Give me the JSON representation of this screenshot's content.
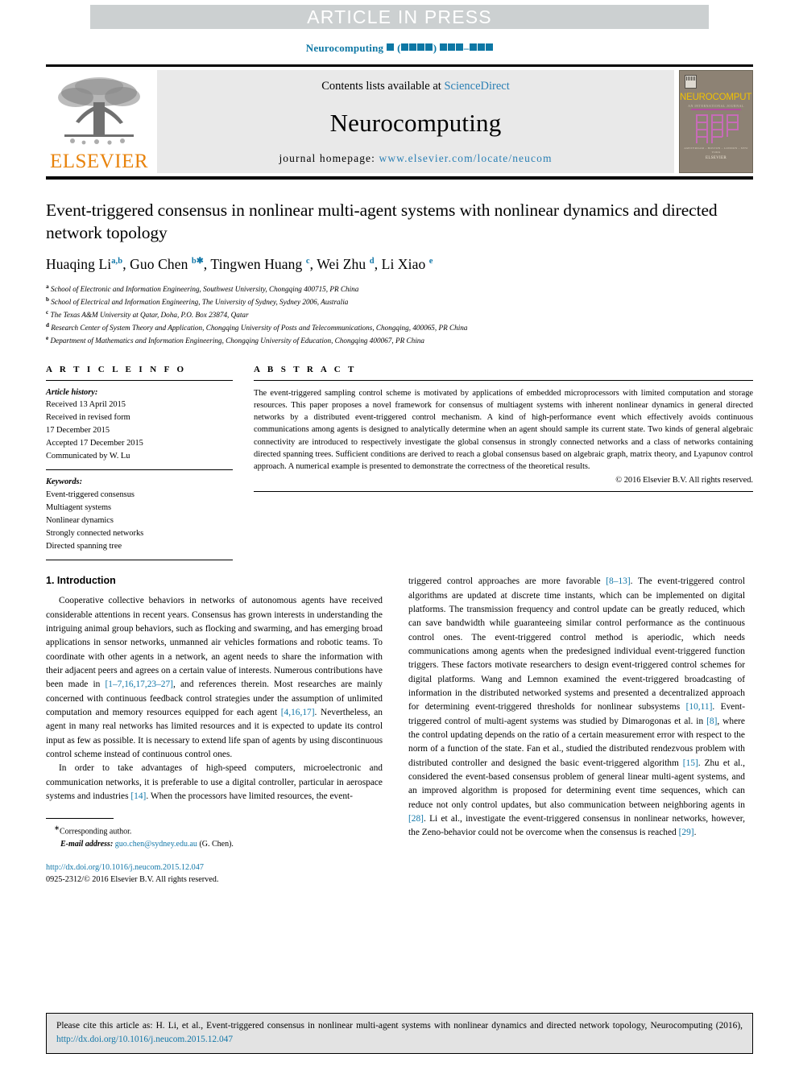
{
  "banner": {
    "text": "ARTICLE IN PRESS"
  },
  "journal_line": {
    "name": "Neurocomputing",
    "placeholder_note": "▮ (▮▮▮▮) ▮▮▮–▮▮▮"
  },
  "masthead": {
    "contents_prefix": "Contents lists available at",
    "contents_link": "ScienceDirect",
    "journal_title": "Neurocomputing",
    "homepage_label": "journal homepage:",
    "homepage_url": "www.elsevier.com/locate/neucom",
    "publisher": "ELSEVIER",
    "cover_title": "NEUROCOMPUTING",
    "cover_subtitle": "AN INTERNATIONAL JOURNAL",
    "cover_footer_line1": "AMSTERDAM – BOSTON – LONDON – NEW YORK",
    "cover_footer_line2": "ELSEVIER"
  },
  "article": {
    "title": "Event-triggered consensus in nonlinear multi-agent systems with nonlinear dynamics and directed network topology",
    "authors": [
      {
        "name": "Huaqing Li",
        "sup": "a,b",
        "star": false
      },
      {
        "name": "Guo Chen",
        "sup": "b",
        "star": true
      },
      {
        "name": "Tingwen Huang",
        "sup": "c",
        "star": false
      },
      {
        "name": "Wei Zhu",
        "sup": "d",
        "star": false
      },
      {
        "name": "Li Xiao",
        "sup": "e",
        "star": false
      }
    ],
    "affiliations": [
      {
        "mark": "a",
        "text": "School of Electronic and Information Engineering, Southwest University, Chongqing 400715, PR China"
      },
      {
        "mark": "b",
        "text": "School of Electrical and Information Engineering, The University of Sydney, Sydney 2006, Australia"
      },
      {
        "mark": "c",
        "text": "The Texas A&M University at Qatar, Doha, P.O. Box 23874, Qatar"
      },
      {
        "mark": "d",
        "text": "Research Center of System Theory and Application, Chongqing University of Posts and Telecommunications, Chongqing, 400065, PR China"
      },
      {
        "mark": "e",
        "text": "Department of Mathematics and Information Engineering, Chongqing University of Education, Chongqing 400067, PR China"
      }
    ]
  },
  "article_info": {
    "heading": "A R T I C L E   I N F O",
    "history_label": "Article history:",
    "history": [
      "Received 13 April 2015",
      "Received in revised form",
      "17 December 2015",
      "Accepted 17 December 2015",
      "Communicated by W. Lu"
    ],
    "keywords_label": "Keywords:",
    "keywords": [
      "Event-triggered consensus",
      "Multiagent systems",
      "Nonlinear dynamics",
      "Strongly connected networks",
      "Directed spanning tree"
    ]
  },
  "abstract": {
    "heading": "A B S T R A C T",
    "text": "The event-triggered sampling control scheme is motivated by applications of embedded microprocessors with limited computation and storage resources. This paper proposes a novel framework for consensus of multiagent systems with inherent nonlinear dynamics in general directed networks by a distributed event-triggered control mechanism. A kind of high-performance event which effectively avoids continuous communications among agents is designed to analytically determine when an agent should sample its current state. Two kinds of general algebraic connectivity are introduced to respectively investigate the global consensus in strongly connected networks and a class of networks containing directed spanning trees. Sufficient conditions are derived to reach a global consensus based on algebraic graph, matrix theory, and Lyapunov control approach. A numerical example is presented to demonstrate the correctness of the theoretical results.",
    "copyright": "© 2016 Elsevier B.V. All rights reserved."
  },
  "introduction": {
    "heading": "1. Introduction",
    "left_p1_a": "Cooperative collective behaviors in networks of autonomous agents have received considerable attentions in recent years. Consensus has grown interests in understanding the intriguing animal group behaviors, such as flocking and swarming, and has emerging broad applications in sensor networks, unmanned air vehicles formations and robotic teams. To coordinate with other agents in a network, an agent needs to share the information with their adjacent peers and agrees on a certain value of interests. Numerous contributions have been made in ",
    "left_p1_ref1": "[1–7,16,17,23–27]",
    "left_p1_b": ", and references therein. Most researches are mainly concerned with continuous feedback control strategies under the assumption of unlimited computation and memory resources equipped for each agent ",
    "left_p1_ref2": "[4,16,17]",
    "left_p1_c": ". Nevertheless, an agent in many real networks has limited resources and it is expected to update its control input as few as possible. It is necessary to extend life span of agents by using discontinuous control scheme instead of continuous control ones.",
    "left_p2_a": "In order to take advantages of high-speed computers, microelectronic and communication networks, it is preferable to use a digital controller, particular in aerospace systems and industries ",
    "left_p2_ref": "[14]",
    "left_p2_b": ". When the processors have limited resources, the event-",
    "right_p_a": "triggered control approaches are more favorable ",
    "right_ref1": "[8–13]",
    "right_p_b": ". The event-triggered control algorithms are updated at discrete time instants, which can be implemented on digital platforms. The transmission frequency and control update can be greatly reduced, which can save bandwidth while guaranteeing similar control performance as the continuous control ones. The event-triggered control method is aperiodic, which needs communications among agents when the predesigned individual event-triggered function triggers. These factors motivate researchers to design event-triggered control schemes for digital platforms. Wang and Lemnon examined the event-triggered broadcasting of information in the distributed networked systems and presented a decentralized approach for determining event-triggered thresholds for nonlinear subsystems ",
    "right_ref2": "[10,11]",
    "right_p_c": ". Event-triggered control of multi-agent systems was studied by Dimarogonas et al. in ",
    "right_ref3": "[8]",
    "right_p_d": ", where the control updating depends on the ratio of a certain measurement error with respect to the norm of a function of the state. Fan et al., studied the distributed rendezvous problem with distributed controller and designed the basic event-triggered algorithm ",
    "right_ref4": "[15]",
    "right_p_e": ". Zhu et al., considered the event-based consensus problem of general linear multi-agent systems, and an improved algorithm is proposed for determining event time sequences, which can reduce not only control updates, but also communication between neighboring agents in ",
    "right_ref5": "[28]",
    "right_p_f": ". Li et al., investigate the event-triggered consensus in nonlinear networks, however, the Zeno-behavior could not be overcome when the consensus is reached ",
    "right_ref6": "[29]",
    "right_p_g": "."
  },
  "footnote": {
    "star": "∗",
    "corresponding": "Corresponding author.",
    "email_label": "E-mail address:",
    "email": "guo.chen@sydney.edu.au",
    "email_owner": "(G. Chen)."
  },
  "doi_block": {
    "doi_url": "http://dx.doi.org/10.1016/j.neucom.2015.12.047",
    "issn_line": "0925-2312/© 2016 Elsevier B.V. All rights reserved."
  },
  "cite_box": {
    "text_a": "Please cite this article as: H. Li, et al., Event-triggered consensus in nonlinear multi-agent systems with nonlinear dynamics and directed network topology, Neurocomputing (2016), ",
    "link": "http://dx.doi.org/10.1016/j.neucom.2015.12.047"
  },
  "colors": {
    "link_blue": "#1277a8",
    "sd_blue": "#2a7fb4",
    "elsevier_orange": "#E8830C",
    "banner_gray": "#ccd0d1",
    "masthead_gray": "#e9e9e9",
    "cover_bg": "#8d8274",
    "cover_yellow": "#f2c200",
    "cite_box_gray": "#e3e3e3"
  }
}
